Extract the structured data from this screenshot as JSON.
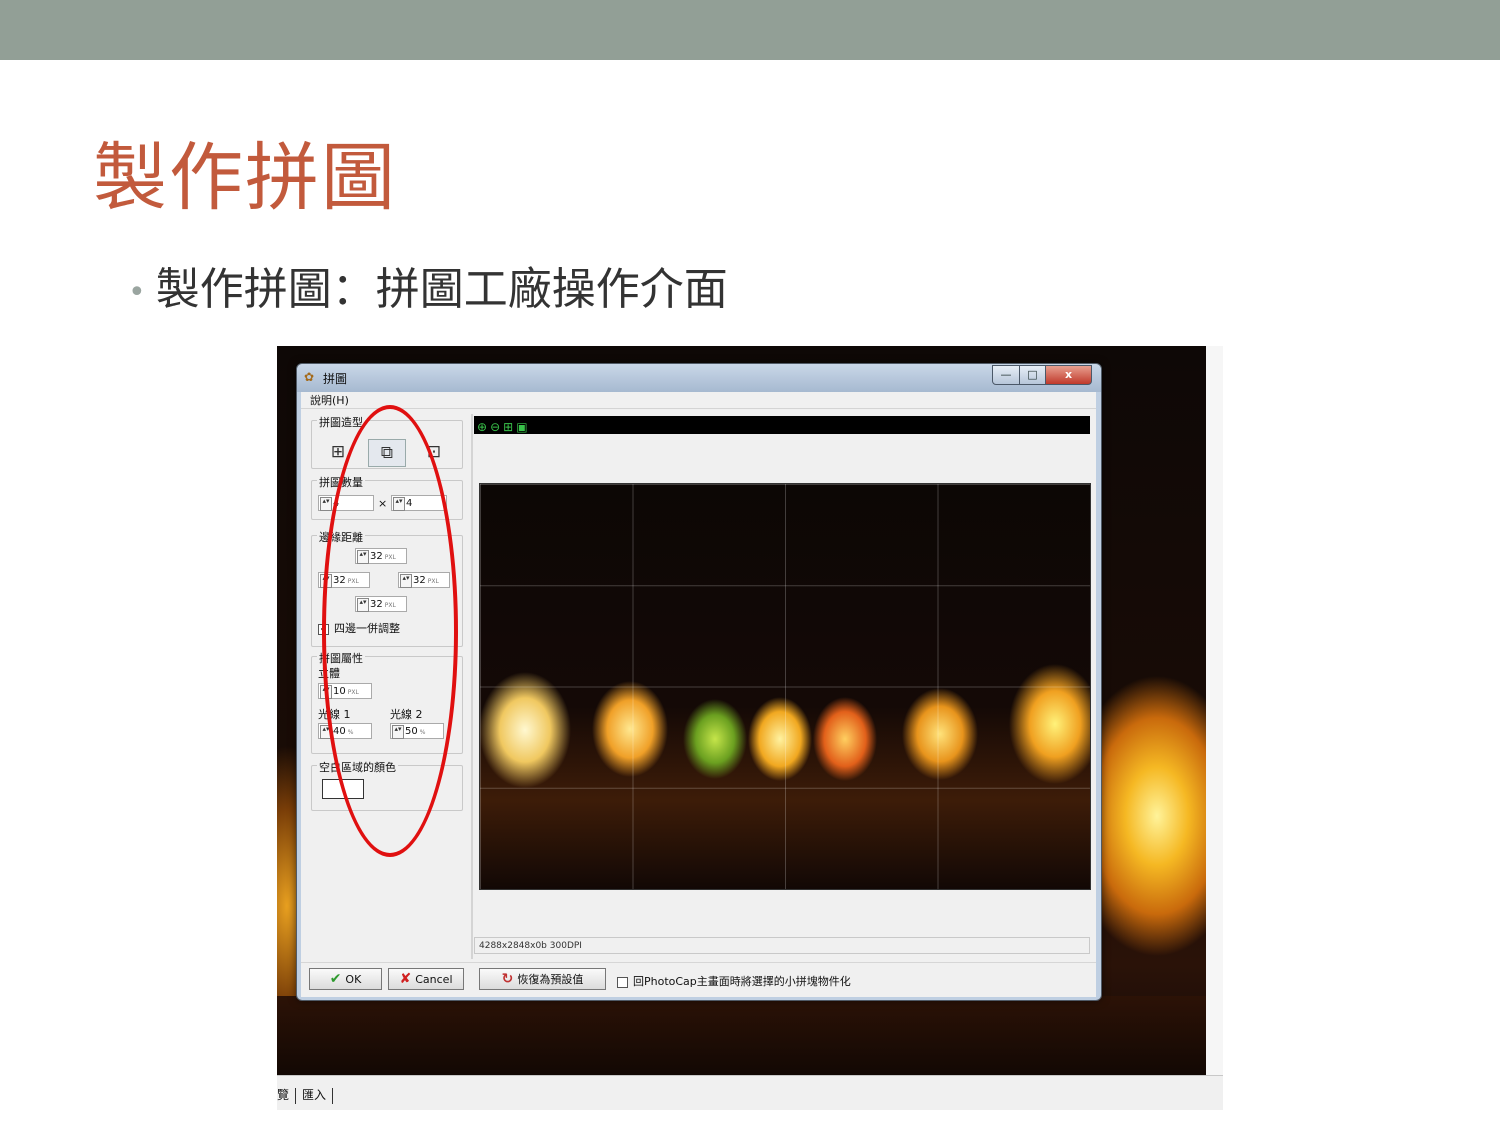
{
  "slide": {
    "title": "製作拼圖",
    "bullet": "製作拼圖：拼圖工廠操作介面"
  },
  "dialog": {
    "title": "拼圖",
    "menu": "說明(H)",
    "window_buttons": {
      "minimize": "—",
      "maximize": "□",
      "close": "x"
    },
    "groups": {
      "puzzle_type": "拼圖造型",
      "puzzle_count": "拼圖數量",
      "margin": "邊緣距離",
      "attributes": "拼圖屬性",
      "blank_color": "空白區域的顏色"
    },
    "count": {
      "cols": "4",
      "times": "×",
      "rows": "4"
    },
    "margin_values": {
      "top": "32",
      "left": "32",
      "right": "32",
      "bottom": "32",
      "unit": "PXL"
    },
    "adjust_all": {
      "label": "四邊一併調整",
      "checked": true
    },
    "solid_label": "立體",
    "solid_value": "10",
    "light1_label": "光線 1",
    "light1_value": "40",
    "light2_label": "光線 2",
    "light2_value": "50",
    "percent_unit": "%",
    "px_unit": "PXL",
    "image_info": "4288x2848x0b  300DPI",
    "buttons": {
      "ok": "OK",
      "cancel": "Cancel",
      "reset": "恢復為預設值"
    },
    "return_option": "回PhotoCap主畫面時將選擇的小拼塊物件化",
    "zoom_tools": [
      "zoom-in-icon",
      "zoom-out-icon",
      "fit-icon",
      "actual-size-icon"
    ]
  },
  "background_app": {
    "bottom_tabs": [
      "覽",
      "匯入"
    ]
  },
  "colors": {
    "topbar": "#929f96",
    "title": "#c25a3c",
    "annotation": "#e01010"
  }
}
